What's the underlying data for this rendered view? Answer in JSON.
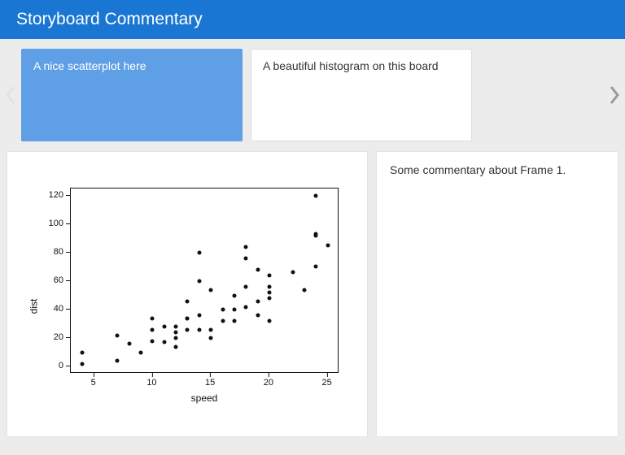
{
  "header": {
    "title": "Storyboard Commentary"
  },
  "nav": {
    "cards": [
      {
        "label": "A nice scatterplot here",
        "active": true
      },
      {
        "label": "A beautiful histogram on this board",
        "active": false
      }
    ]
  },
  "commentary": {
    "text": "Some commentary about Frame 1."
  },
  "chart_data": {
    "type": "scatter",
    "xlabel": "speed",
    "ylabel": "dist",
    "xlim": [
      3,
      26
    ],
    "ylim": [
      -5,
      125
    ],
    "x_ticks": [
      5,
      10,
      15,
      20,
      25
    ],
    "y_ticks": [
      0,
      20,
      40,
      60,
      80,
      100,
      120
    ],
    "x": [
      4,
      4,
      7,
      7,
      8,
      9,
      10,
      10,
      10,
      11,
      11,
      12,
      12,
      12,
      12,
      13,
      13,
      13,
      13,
      14,
      14,
      14,
      14,
      15,
      15,
      15,
      16,
      16,
      17,
      17,
      17,
      18,
      18,
      18,
      18,
      19,
      19,
      19,
      20,
      20,
      20,
      20,
      20,
      22,
      23,
      24,
      24,
      24,
      24,
      25
    ],
    "y": [
      2,
      10,
      4,
      22,
      16,
      10,
      18,
      26,
      34,
      17,
      28,
      14,
      20,
      24,
      28,
      26,
      34,
      34,
      46,
      26,
      36,
      60,
      80,
      20,
      26,
      54,
      32,
      40,
      32,
      40,
      50,
      42,
      56,
      76,
      84,
      36,
      46,
      68,
      32,
      48,
      52,
      56,
      64,
      66,
      54,
      70,
      92,
      93,
      120,
      85
    ]
  }
}
